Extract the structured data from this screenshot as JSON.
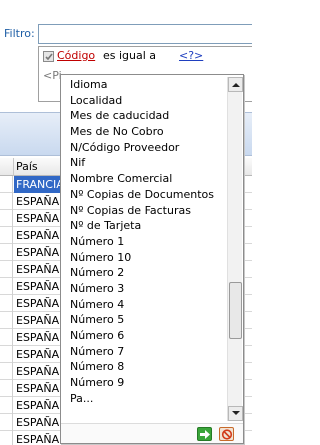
{
  "filter": {
    "label": "Filtro:",
    "value": ""
  },
  "condition": {
    "checked": true,
    "field": "Código",
    "operator": "es igual a",
    "value": "<?>",
    "second_row": "<Pi"
  },
  "grid": {
    "column_title": "País",
    "rows": [
      {
        "pais": "FRANCIA",
        "selected": true
      },
      {
        "pais": "ESPAÑA"
      },
      {
        "pais": "ESPAÑA"
      },
      {
        "pais": "ESPAÑA"
      },
      {
        "pais": "ESPAÑA"
      },
      {
        "pais": "ESPAÑA"
      },
      {
        "pais": "ESPAÑA"
      },
      {
        "pais": "ESPAÑA"
      },
      {
        "pais": "ESPAÑA"
      },
      {
        "pais": "ESPAÑA"
      },
      {
        "pais": "ESPAÑA"
      },
      {
        "pais": "ESPAÑA"
      },
      {
        "pais": "ESPAÑA"
      },
      {
        "pais": "ESPAÑA"
      },
      {
        "pais": "ESPAÑA"
      },
      {
        "pais": "ESPAÑA"
      }
    ]
  },
  "field_list": {
    "items": [
      "Idioma",
      "Localidad",
      "Mes de caducidad",
      "Mes de No Cobro",
      "N/Código Proveedor",
      "Nif",
      "Nombre Comercial",
      "Nº Copias de Documentos",
      "Nº Copias de Facturas",
      "Nº de Tarjeta",
      "Número 1",
      "Número 10",
      "Número 2",
      "Número 3",
      "Número 4",
      "Número 5",
      "Número 6",
      "Número 7",
      "Número 8",
      "Número 9",
      "Pa..."
    ],
    "scroll_position": 0.74,
    "scroll_visible_fraction": 0.18,
    "accept_icon": "green-arrow-right-icon",
    "cancel_icon": "red-no-entry-icon"
  }
}
